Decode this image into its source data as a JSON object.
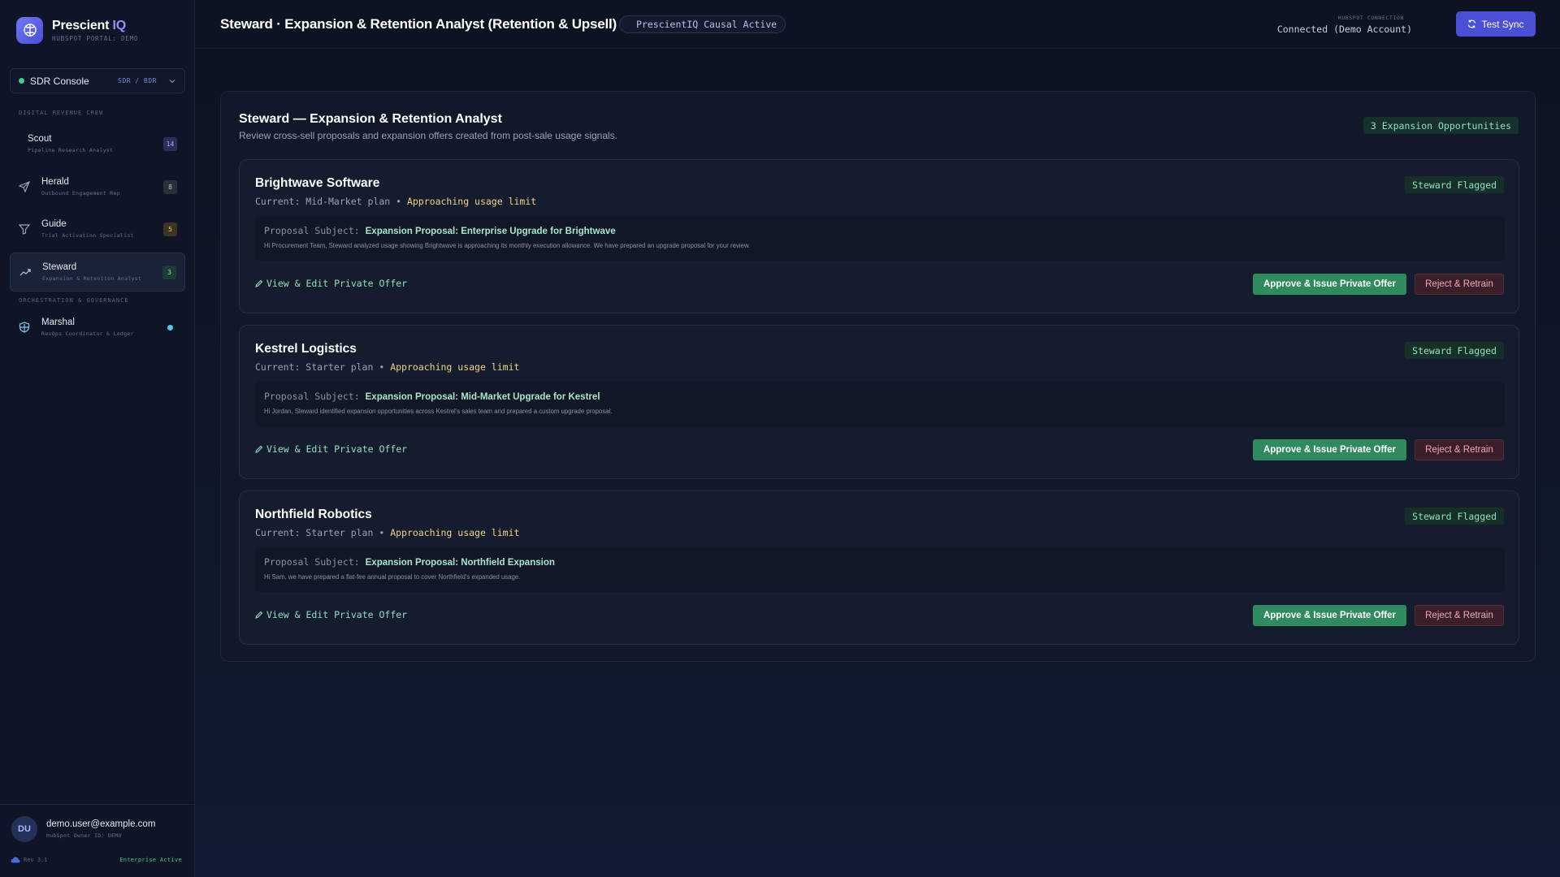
{
  "brand": {
    "name": "Prescient",
    "accent": "IQ",
    "portal": "HUBSPOT PORTAL: DEMO",
    "icon": "brain-icon"
  },
  "console": {
    "label": "SDR Console",
    "mode": "SDR / BDR"
  },
  "sidebar": {
    "section_crew": "DIGITAL REVENUE CREW",
    "section_orchestration": "ORCHESTRATION & GOVERNANCE",
    "items": [
      {
        "label": "Scout",
        "sub": "Pipeline Research Analyst",
        "badge": "14",
        "icon": ""
      },
      {
        "label": "Herald",
        "sub": "Outbound Engagement Rep",
        "badge": "8",
        "icon": "send-icon"
      },
      {
        "label": "Guide",
        "sub": "Trial Activation Specialist",
        "badge": "5",
        "icon": "filter-icon"
      },
      {
        "label": "Steward",
        "sub": "Expansion & Retention Analyst",
        "badge": "3",
        "icon": "trending-up-icon"
      },
      {
        "label": "Marshal",
        "sub": "RevOps Coordinator & Ledger",
        "icon": "shield-icon"
      }
    ]
  },
  "user": {
    "initials": "DU",
    "email": "demo.user@example.com",
    "owner": "HubSpot Owner ID: DEMO",
    "rev": "Rev 3.1",
    "plan": "Enterprise Active"
  },
  "header": {
    "title": "Steward · Expansion & Retention Analyst (Retention & Upsell)",
    "causal": "PrescientIQ Causal Active",
    "conn_label": "HUBSPOT CONNECTION",
    "conn_value": "Connected (Demo Account)",
    "sync_label": "Test Sync"
  },
  "panel": {
    "title": "Steward — Expansion & Retention Analyst",
    "subtitle": "Review cross-sell proposals and expansion offers created from post-sale usage signals.",
    "count": "3 Expansion Opportunities"
  },
  "cards": [
    {
      "name": "Brightwave Software",
      "plan": "Current: Mid-Market plan",
      "status": "Approaching usage limit",
      "flag": "Steward Flagged",
      "proposal_label": "Proposal Subject:",
      "subject": "Expansion Proposal: Enterprise Upgrade for Brightwave",
      "body": "Hi Procurement Team, Steward analyzed usage showing Brightwave is approaching its monthly execution allowance. We have prepared an upgrade proposal for your review.",
      "edit": "View & Edit Private Offer",
      "approve": "Approve & Issue Private Offer",
      "reject": "Reject & Retrain"
    },
    {
      "name": "Kestrel Logistics",
      "plan": "Current: Starter plan",
      "status": "Approaching usage limit",
      "flag": "Steward Flagged",
      "proposal_label": "Proposal Subject:",
      "subject": "Expansion Proposal: Mid-Market Upgrade for Kestrel",
      "body": "Hi Jordan, Steward identified expansion opportunities across Kestrel's sales team and prepared a custom upgrade proposal.",
      "edit": "View & Edit Private Offer",
      "approve": "Approve & Issue Private Offer",
      "reject": "Reject & Retrain"
    },
    {
      "name": "Northfield Robotics",
      "plan": "Current: Starter plan",
      "status": "Approaching usage limit",
      "flag": "Steward Flagged",
      "proposal_label": "Proposal Subject:",
      "subject": "Expansion Proposal: Northfield Expansion",
      "body": "Hi Sam, we have prepared a flat-fee annual proposal to cover Northfield's expanded usage.",
      "edit": "View & Edit Private Offer",
      "approve": "Approve & Issue Private Offer",
      "reject": "Reject & Retrain"
    }
  ],
  "colors": {
    "accent": "#4a4fd6",
    "success": "#2f8a5e",
    "danger": "#3a1e2a",
    "background": "#0c1120"
  }
}
